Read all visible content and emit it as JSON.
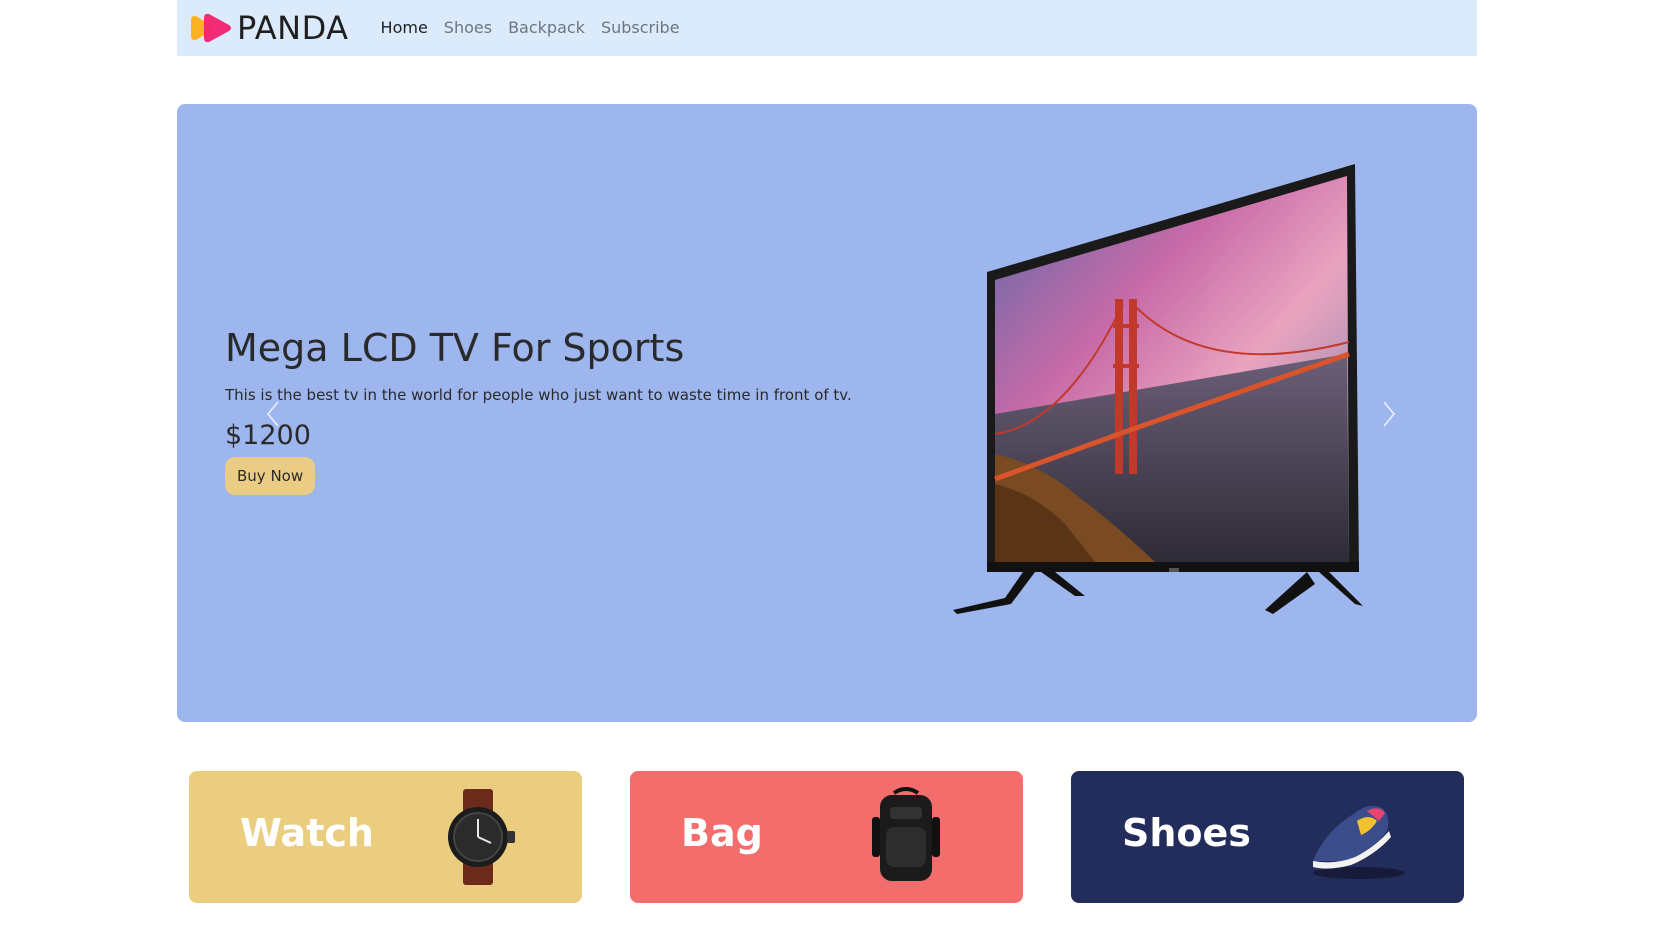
{
  "brand": {
    "name": "PANDA",
    "logo_icon": "brand-logo-icon"
  },
  "nav": {
    "items": [
      {
        "label": "Home",
        "active": true
      },
      {
        "label": "Shoes",
        "active": false
      },
      {
        "label": "Backpack",
        "active": false
      },
      {
        "label": "Subscribe",
        "active": false
      }
    ]
  },
  "hero": {
    "title": "Mega LCD TV For Sports",
    "description": "This is the best tv in the world for people who just want to waste time in front of tv.",
    "price": "$1200",
    "button_label": "Buy Now",
    "background_color": "#9eb6ee",
    "button_color": "#ebcc84",
    "prev_icon": "chevron-left-icon",
    "next_icon": "chevron-right-icon",
    "image": "tv-image"
  },
  "categories": [
    {
      "label": "Watch",
      "color": "#ebcd80",
      "image": "watch-image"
    },
    {
      "label": "Bag",
      "color": "#f46d6d",
      "image": "backpack-image"
    },
    {
      "label": "Shoes",
      "color": "#232d5b",
      "image": "sneaker-image"
    }
  ]
}
